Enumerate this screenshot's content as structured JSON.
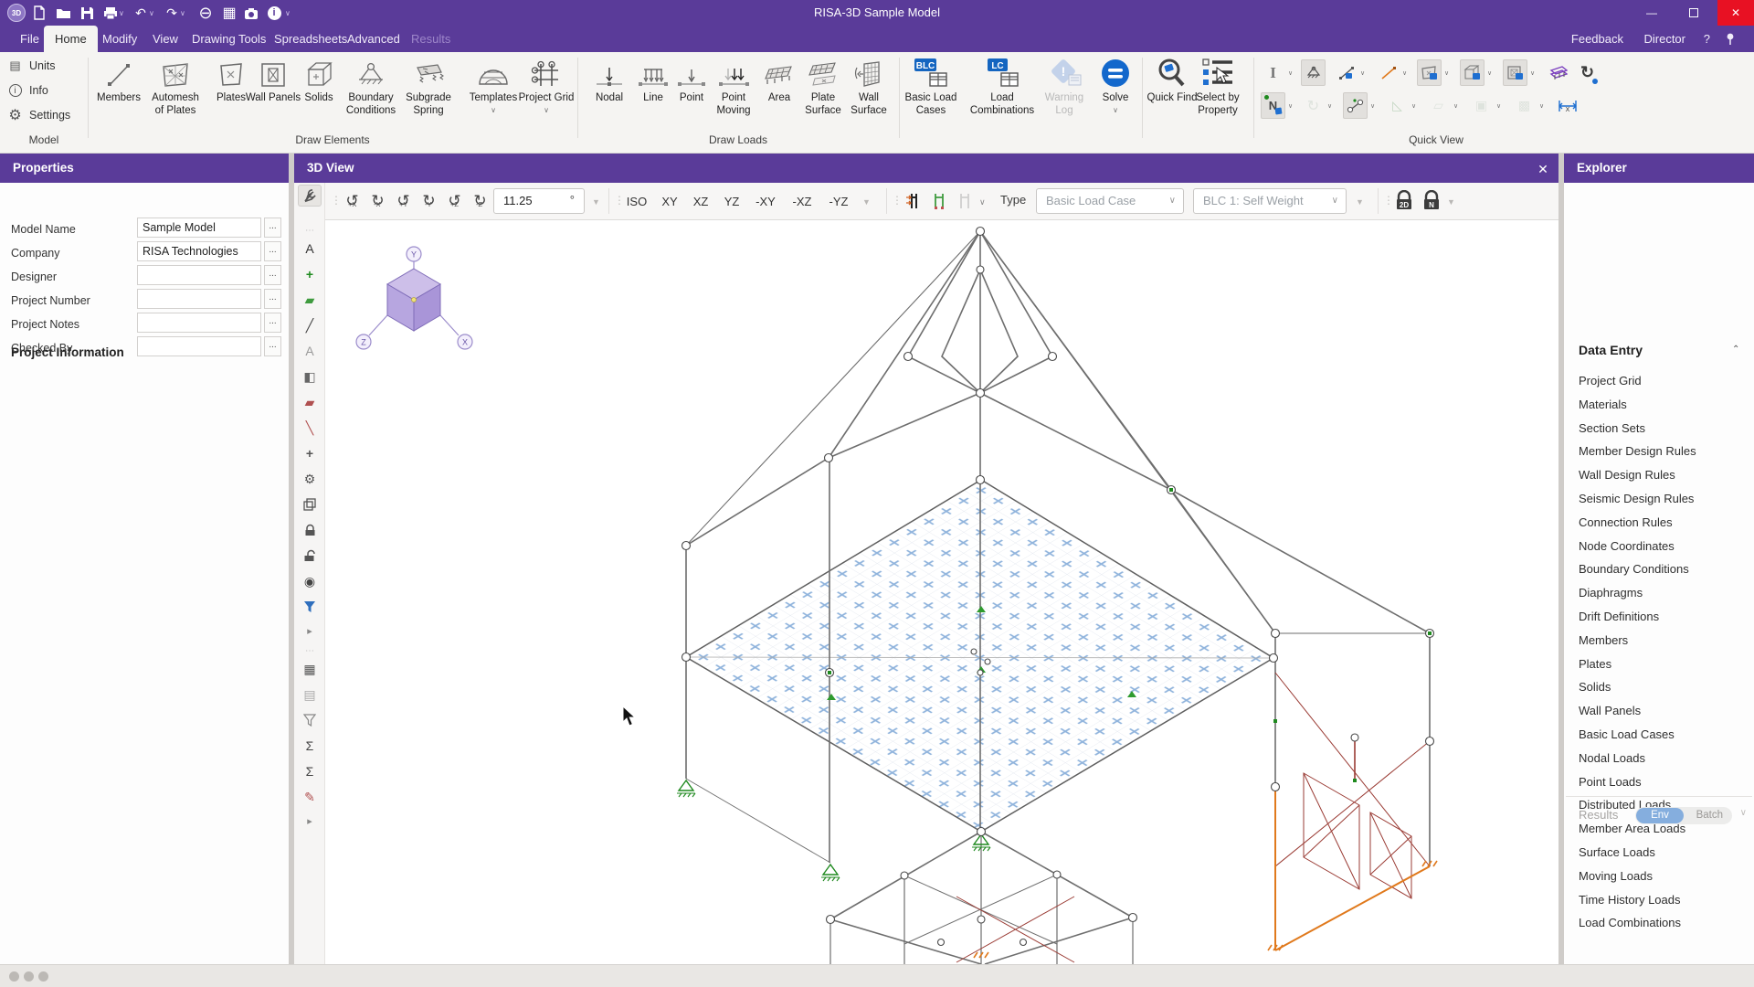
{
  "titlebar": {
    "title": "RISA-3D Sample Model"
  },
  "menu": {
    "items": [
      "File",
      "Home",
      "Modify",
      "View",
      "Drawing Tools",
      "Spreadsheets",
      "Advanced",
      "Results"
    ],
    "right": {
      "feedback": "Feedback",
      "director": "Director",
      "help": "?"
    }
  },
  "ribbon": {
    "group_labels": {
      "model": "Model",
      "draw_elements": "Draw Elements",
      "draw_loads": "Draw Loads",
      "quick_view": "Quick View"
    },
    "model_items": [
      "Units",
      "Info",
      "Settings"
    ],
    "draw_elements": [
      "Members",
      "Automesh of Plates",
      "Plates",
      "Wall Panels",
      "Solids",
      "Boundary Conditions",
      "Subgrade Spring",
      "Templates",
      "Project Grid"
    ],
    "draw_loads": [
      "Nodal",
      "Line",
      "Point",
      "Point Moving",
      "Area",
      "Plate Surface",
      "Wall Surface"
    ],
    "analysis": {
      "blc_tag": "BLC",
      "lc_tag": "LC",
      "items": [
        "Basic Load Cases",
        "Load Combinations",
        "Warning Log",
        "Solve"
      ]
    },
    "find": [
      "Quick Find",
      "Select by Property"
    ],
    "icons": [
      "app-logo",
      "new-file",
      "open-folder",
      "save",
      "print",
      "undo",
      "redo",
      "engineering-tools",
      "spreadsheet",
      "snapshot",
      "info"
    ]
  },
  "properties": {
    "header": "Properties",
    "section": "Project Information",
    "fields": [
      {
        "label": "Model Name",
        "value": "Sample Model"
      },
      {
        "label": "Company",
        "value": "RISA Technologies"
      },
      {
        "label": "Designer",
        "value": ""
      },
      {
        "label": "Project Number",
        "value": ""
      },
      {
        "label": "Project Notes",
        "value": ""
      },
      {
        "label": "Checked By",
        "value": ""
      }
    ],
    "dots": "..."
  },
  "view3d": {
    "header": "3D View",
    "rotate": [
      "+X",
      "-X",
      "+Y",
      "-Y",
      "+Z",
      "-Z"
    ],
    "angle": "11.25",
    "degree": "°",
    "views": [
      "ISO",
      "XY",
      "XZ",
      "YZ",
      "-XY",
      "-XZ",
      "-YZ"
    ],
    "type_label": "Type",
    "load_case_combo": "Basic Load Case",
    "blc_combo": "BLC 1: Self Weight",
    "lock_2d": "2D",
    "lock_n": "N",
    "cube": {
      "x": "X",
      "y": "Y",
      "z": "Z"
    },
    "quick_node_letter": "N",
    "dim_letter": "X"
  },
  "explorer": {
    "header": "Explorer",
    "section": "Data Entry",
    "items": [
      "Project Grid",
      "Materials",
      "Section Sets",
      "Member Design Rules",
      "Wall Design Rules",
      "Seismic Design Rules",
      "Connection Rules",
      "Node Coordinates",
      "Boundary Conditions",
      "Diaphragms",
      "Drift Definitions",
      "Members",
      "Plates",
      "Solids",
      "Wall Panels",
      "Basic Load Cases",
      "Nodal Loads",
      "Point Loads",
      "Distributed Loads",
      "Member Area Loads",
      "Surface Loads",
      "Moving Loads",
      "Time History Loads",
      "Load Combinations"
    ],
    "results": {
      "label": "Results",
      "env": "Env",
      "batch": "Batch"
    }
  },
  "colors": {
    "purple": "#5a3b99",
    "accent_blue": "#1368cc",
    "support_green": "#1f8a1f",
    "member_orange": "#e0791c",
    "brace_red": "#9a3b34"
  }
}
